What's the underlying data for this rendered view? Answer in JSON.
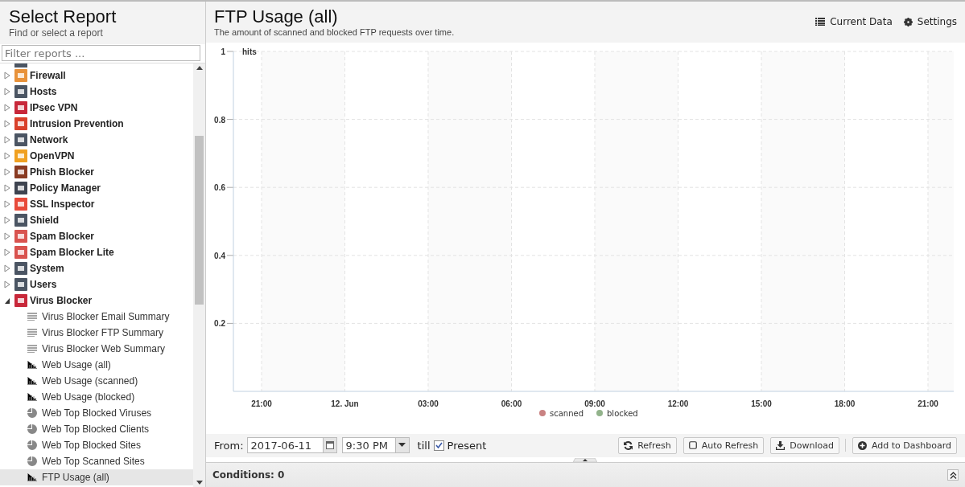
{
  "sidebar": {
    "title": "Select Report",
    "subtitle": "Find or select a report",
    "filter": {
      "placeholder": "Filter reports ..."
    },
    "tree": [
      {
        "label": "Firewall",
        "color": "#e8923a",
        "expanded": false
      },
      {
        "label": "Hosts",
        "color": "#4b5563",
        "expanded": false
      },
      {
        "label": "IPsec VPN",
        "color": "#c8283a",
        "expanded": false
      },
      {
        "label": "Intrusion Prevention",
        "color": "#d9412b",
        "expanded": false
      },
      {
        "label": "Network",
        "color": "#4b5563",
        "expanded": false
      },
      {
        "label": "OpenVPN",
        "color": "#f0a020",
        "expanded": false
      },
      {
        "label": "Phish Blocker",
        "color": "#8a3b22",
        "expanded": false
      },
      {
        "label": "Policy Manager",
        "color": "#3e4450",
        "expanded": false
      },
      {
        "label": "SSL Inspector",
        "color": "#e84a3a",
        "expanded": false
      },
      {
        "label": "Shield",
        "color": "#4b5563",
        "expanded": false
      },
      {
        "label": "Spam Blocker",
        "color": "#d9534f",
        "expanded": false
      },
      {
        "label": "Spam Blocker Lite",
        "color": "#d9534f",
        "expanded": false
      },
      {
        "label": "System",
        "color": "#4b5563",
        "expanded": false
      },
      {
        "label": "Users",
        "color": "#4b5563",
        "expanded": false
      },
      {
        "label": "Virus Blocker",
        "color": "#c8283a",
        "expanded": true,
        "children": [
          {
            "label": "Virus Blocker Email Summary",
            "kind": "text",
            "selected": false
          },
          {
            "label": "Virus Blocker FTP Summary",
            "kind": "text",
            "selected": false
          },
          {
            "label": "Virus Blocker Web Summary",
            "kind": "text",
            "selected": false
          },
          {
            "label": "Web Usage (all)",
            "kind": "bar",
            "selected": false
          },
          {
            "label": "Web Usage (scanned)",
            "kind": "bar",
            "selected": false
          },
          {
            "label": "Web Usage (blocked)",
            "kind": "bar",
            "selected": false
          },
          {
            "label": "Web Top Blocked Viruses",
            "kind": "pie",
            "selected": false
          },
          {
            "label": "Web Top Blocked Clients",
            "kind": "pie",
            "selected": false
          },
          {
            "label": "Web Top Blocked Sites",
            "kind": "pie",
            "selected": false
          },
          {
            "label": "Web Top Scanned Sites",
            "kind": "pie",
            "selected": false
          },
          {
            "label": "FTP Usage (all)",
            "kind": "bar",
            "selected": true
          }
        ]
      }
    ]
  },
  "report": {
    "title": "FTP Usage (all)",
    "description": "The amount of scanned and blocked FTP requests over time.",
    "actions": [
      {
        "label": "Current Data",
        "kind": "list"
      },
      {
        "label": "Settings",
        "kind": "gear"
      }
    ],
    "chart_data": {
      "type": "line",
      "ylabel": "hits",
      "ylim": [
        0,
        1
      ],
      "yticks": [
        0.2,
        0.4,
        0.6,
        0.8,
        1
      ],
      "categories": [
        "21:00",
        "12. Jun",
        "03:00",
        "06:00",
        "09:00",
        "12:00",
        "15:00",
        "18:00",
        "21:00"
      ],
      "grid": true,
      "series": [
        {
          "name": "scanned",
          "color": "#c98282",
          "values": [
            null,
            null,
            null,
            null,
            null,
            null,
            null,
            null,
            null
          ]
        },
        {
          "name": "blocked",
          "color": "#92b38b",
          "values": [
            null,
            null,
            null,
            null,
            null,
            null,
            null,
            null,
            null
          ]
        }
      ]
    }
  },
  "toolbar": {
    "from_label": "From:",
    "date": "2017-06-11",
    "time": "9:30 PM",
    "till_label": "till",
    "present": {
      "label": "Present",
      "checked": true
    },
    "buttons": [
      {
        "label": "Refresh",
        "kind": "refresh"
      },
      {
        "label": "Auto Refresh",
        "kind": "checkbox"
      },
      {
        "label": "Download",
        "kind": "download"
      },
      {
        "label": "Add to Dashboard",
        "kind": "add"
      }
    ]
  },
  "conditions": {
    "label": "Conditions: 0"
  }
}
